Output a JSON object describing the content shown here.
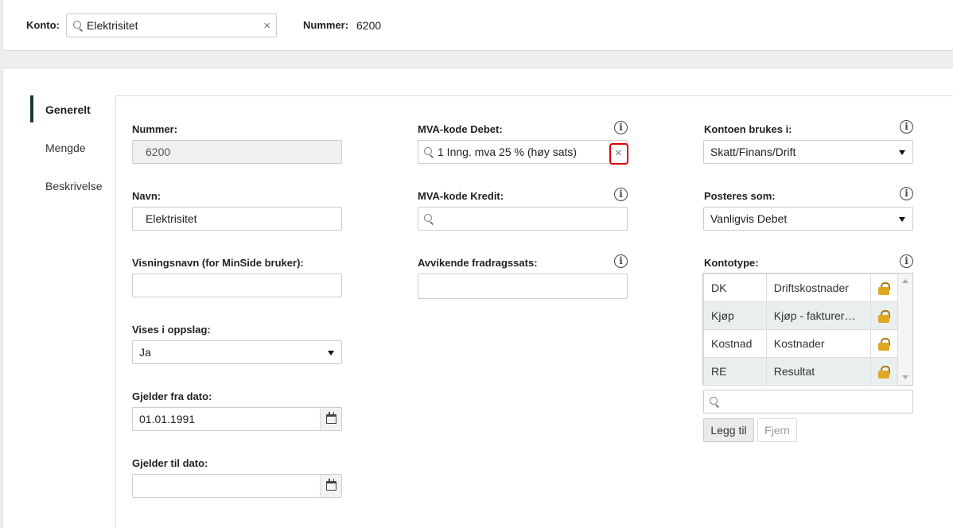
{
  "topbar": {
    "konto_label": "Konto:",
    "konto_value": "Elektrisitet",
    "clear_glyph": "×",
    "nummer_label": "Nummer:",
    "nummer_value": "6200"
  },
  "sidebar": {
    "items": [
      {
        "label": "Generelt",
        "active": true
      },
      {
        "label": "Mengde",
        "active": false
      },
      {
        "label": "Beskrivelse",
        "active": false
      }
    ]
  },
  "form": {
    "col1": {
      "nummer": {
        "label": "Nummer:",
        "value": "6200"
      },
      "navn": {
        "label": "Navn:",
        "value": "Elektrisitet"
      },
      "visningsnavn": {
        "label": "Visningsnavn (for MinSide bruker):",
        "value": ""
      },
      "vises": {
        "label": "Vises i oppslag:",
        "value": "Ja"
      },
      "fra_dato": {
        "label": "Gjelder fra dato:",
        "value": "01.01.1991"
      },
      "til_dato": {
        "label": "Gjelder til dato:",
        "value": ""
      }
    },
    "col2": {
      "mva_debet": {
        "label": "MVA-kode Debet:",
        "value": "1 Inng. mva 25 % (høy sats)",
        "clear_glyph": "×"
      },
      "mva_kredit": {
        "label": "MVA-kode Kredit:",
        "value": ""
      },
      "fradragssats": {
        "label": "Avvikende fradragssats:",
        "value": ""
      }
    },
    "col3": {
      "brukes_i": {
        "label": "Kontoen brukes i:",
        "value": "Skatt/Finans/Drift"
      },
      "posteres": {
        "label": "Posteres som:",
        "value": "Vanligvis Debet"
      },
      "kontotype": {
        "label": "Kontotype:",
        "rows": [
          {
            "code": "DK",
            "name": "Driftskostnader"
          },
          {
            "code": "Kjøp",
            "name": "Kjøp - fakturer…"
          },
          {
            "code": "Kostnad",
            "name": "Kostnader"
          },
          {
            "code": "RE",
            "name": "Resultat"
          }
        ],
        "search_value": "",
        "add_label": "Legg til",
        "remove_label": "Fjern"
      }
    },
    "info_glyph": "i"
  },
  "colors": {
    "accent": "#1d3b2c",
    "alt_row": "#e9efee",
    "highlight": "#e00000",
    "lock": "#e0a820"
  },
  "icons": [
    "search-icon",
    "clear-icon",
    "info-icon",
    "calendar-icon",
    "dropdown-arrow-icon",
    "lock-icon"
  ]
}
